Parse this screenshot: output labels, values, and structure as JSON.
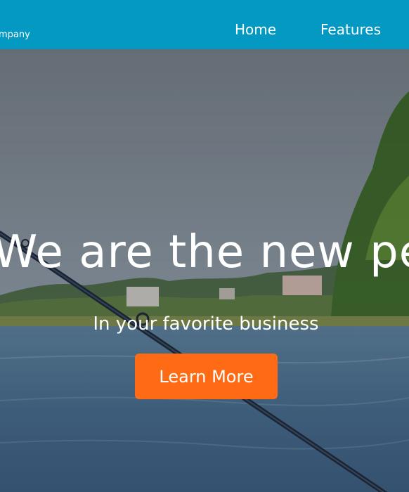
{
  "navbar": {
    "brand": "mpany",
    "links": [
      {
        "label": "Home"
      },
      {
        "label": "Features"
      }
    ]
  },
  "hero": {
    "title": "We are the new pea",
    "subtitle": "In your favorite business",
    "cta_label": "Learn More"
  },
  "colors": {
    "navbar": "#0399c2",
    "cta": "#ff6b14",
    "text": "#ffffff"
  }
}
